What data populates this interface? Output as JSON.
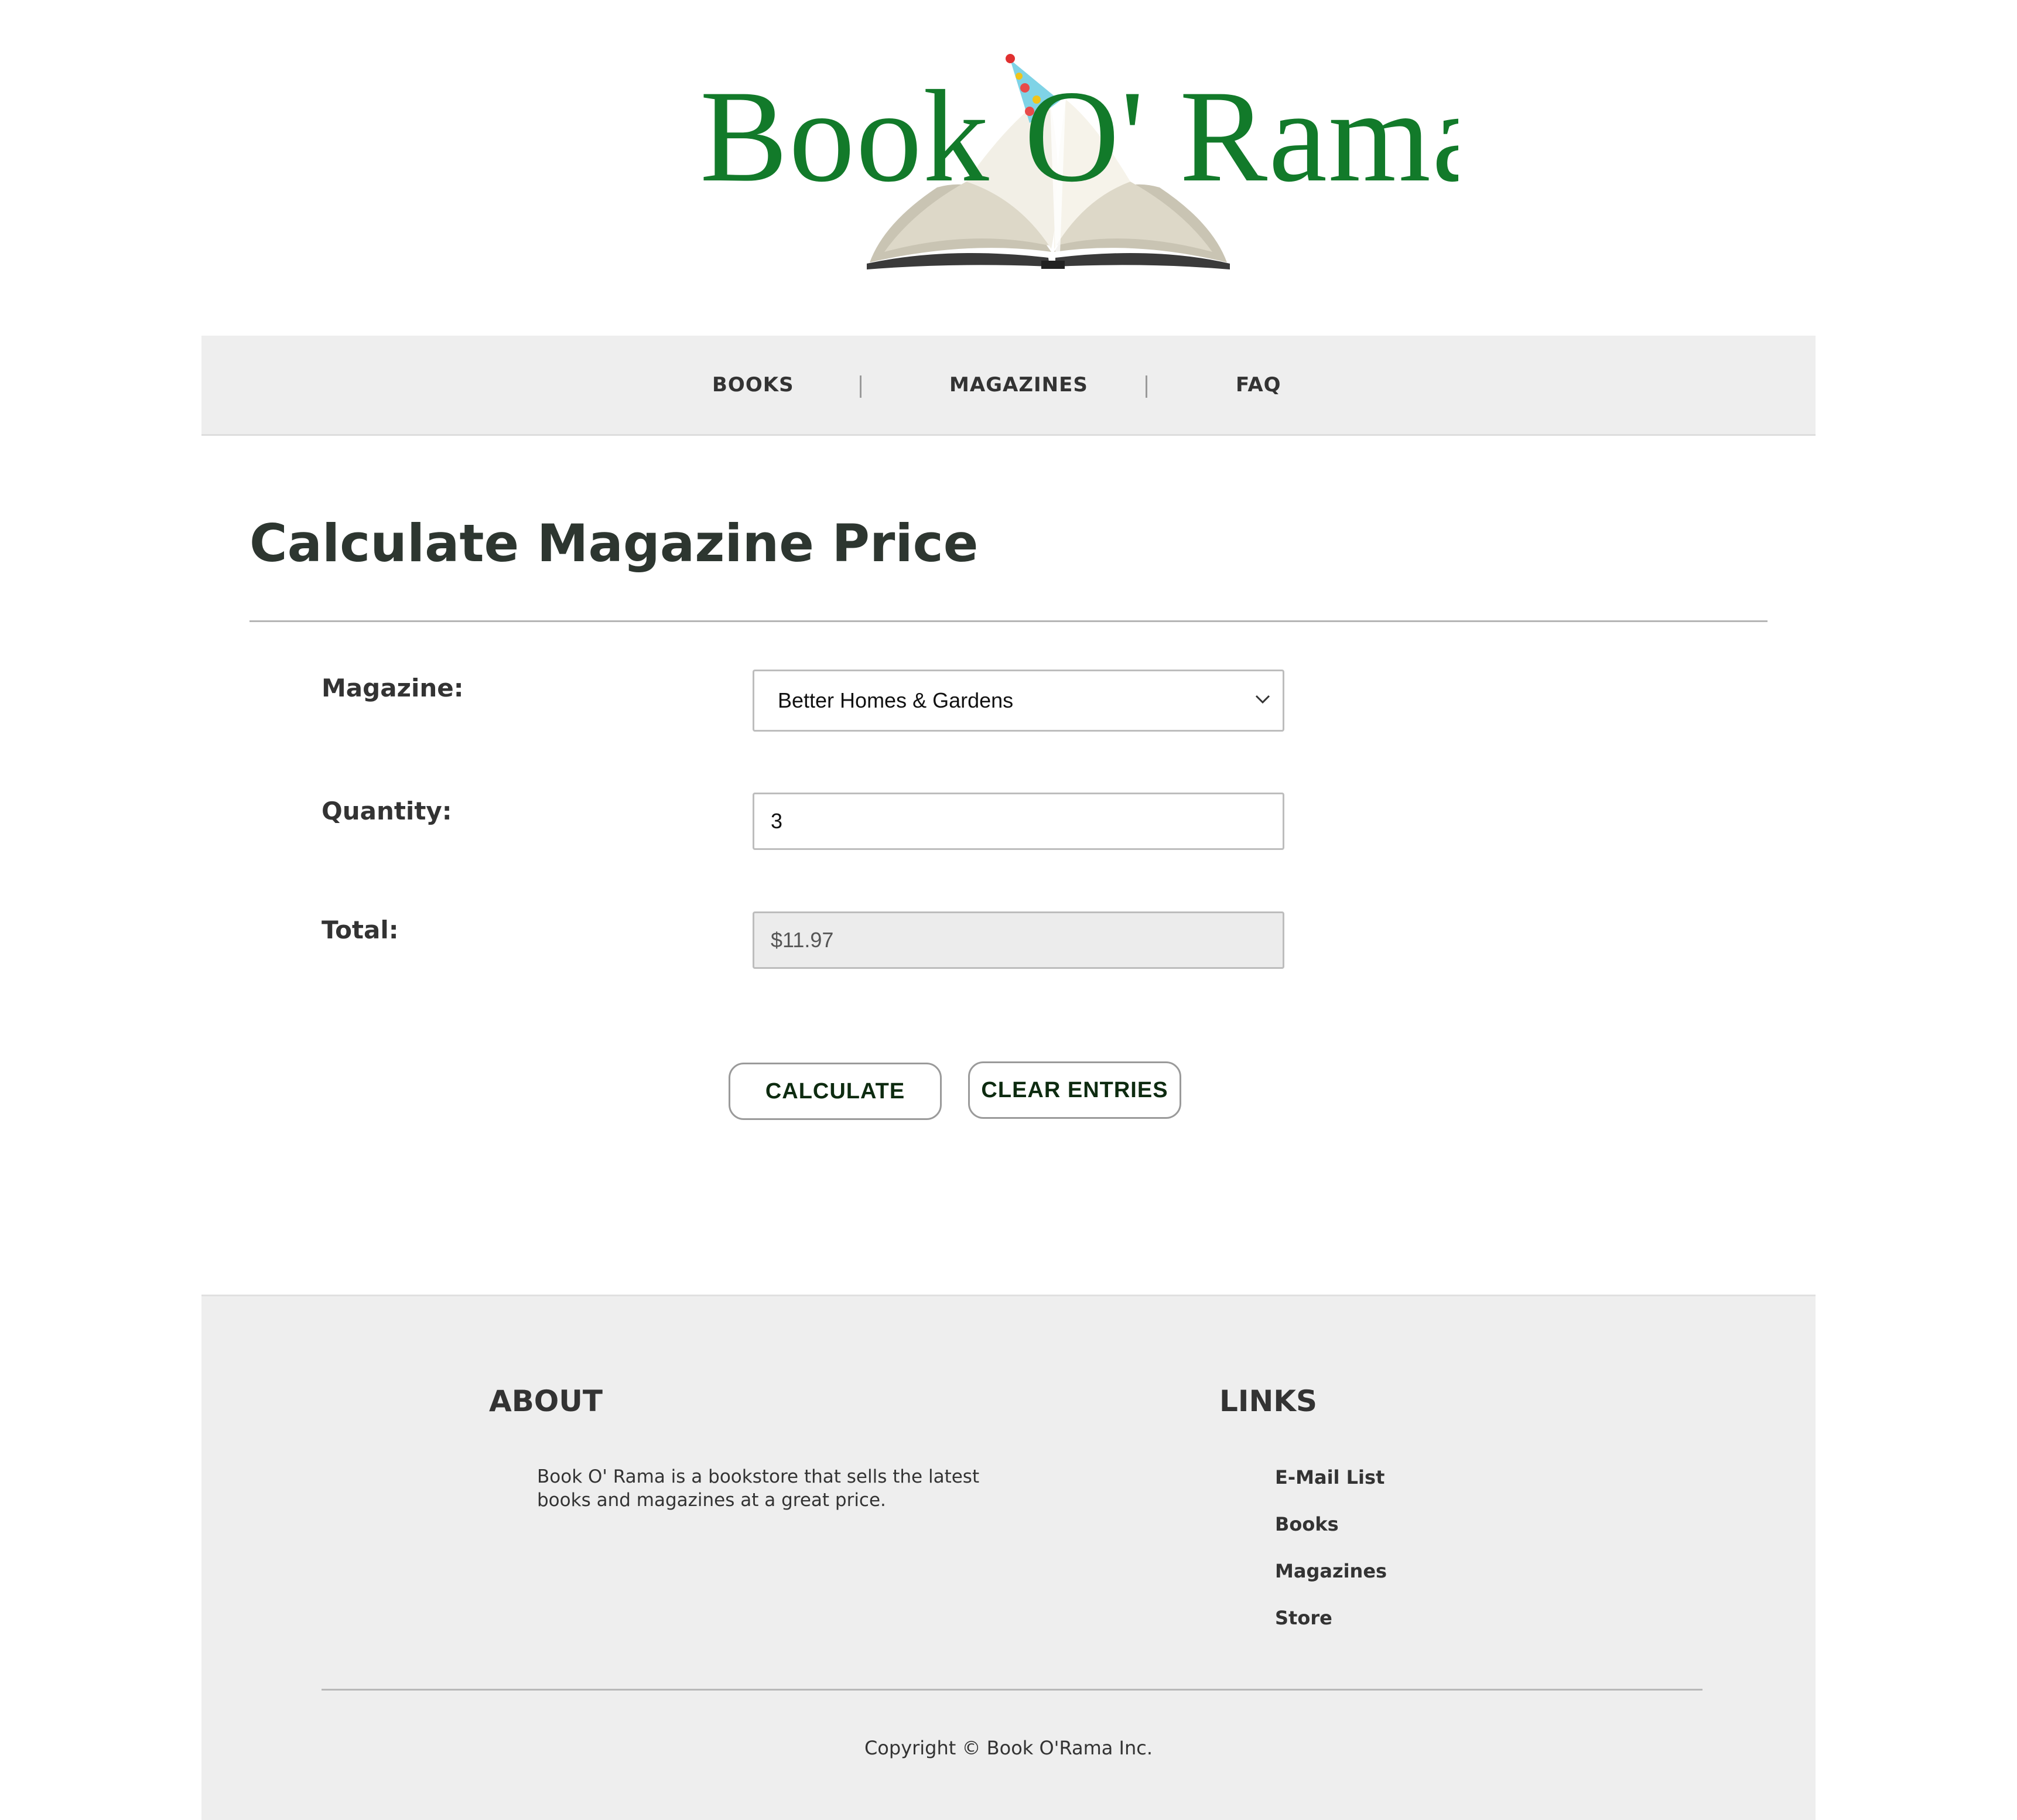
{
  "logo": {
    "text": "Book O' Rama",
    "brand_color": "#127a2a",
    "icons": [
      "party-hat-icon",
      "open-book-icon"
    ]
  },
  "nav": {
    "items": [
      "BOOKS",
      "MAGAZINES",
      "FAQ"
    ]
  },
  "main": {
    "title": "Calculate Magazine Price",
    "magazine_label": "Magazine:",
    "magazine_value": "Better Homes & Gardens",
    "quantity_label": "Quantity:",
    "quantity_value": "3",
    "total_label": "Total:",
    "total_value": "$11.97",
    "calculate_label": "CALCULATE",
    "clear_label": "CLEAR ENTRIES"
  },
  "footer": {
    "about_heading": "ABOUT",
    "about_text": "Book O' Rama is a bookstore that sells the latest books and magazines at a great price.",
    "links_heading": "LINKS",
    "links": [
      "E-Mail List",
      "Books",
      "Magazines",
      "Store"
    ],
    "copyright": "Copyright © Book O'Rama Inc."
  },
  "colors": {
    "nav_bg": "#eeeeee",
    "footer_bg": "#eeeeee",
    "title": "#2d3630",
    "button_text": "#0d2b10"
  }
}
